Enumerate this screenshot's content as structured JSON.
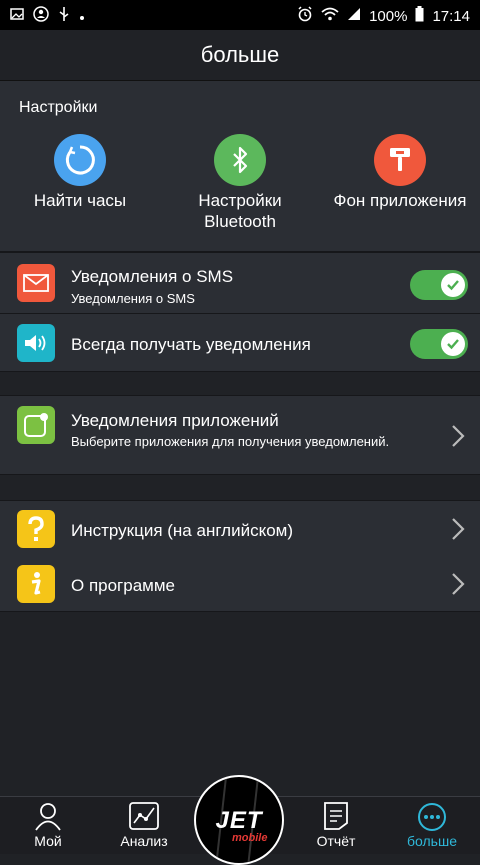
{
  "status_bar": {
    "battery": "100%",
    "time": "17:14"
  },
  "header": {
    "title": "больше"
  },
  "settings": {
    "label": "Настройки",
    "quick_actions": [
      {
        "label": "Найти часы",
        "icon": "find-watch-icon",
        "color": "#4aa3ef"
      },
      {
        "label_line1": "Настройки",
        "label_line2": "Bluetooth",
        "icon": "bluetooth-icon",
        "color": "#5cb85c"
      },
      {
        "label": "Фон приложения",
        "icon": "paint-roller-icon",
        "color": "#f0583c"
      }
    ]
  },
  "rows": {
    "sms": {
      "title": "Уведомления о SMS",
      "subtitle": "Уведомления о SMS",
      "enabled": true,
      "icon": "envelope-icon",
      "color": "#f0583c"
    },
    "always": {
      "title": "Всегда получать уведомления",
      "enabled": true,
      "icon": "speaker-icon",
      "color": "#1fb5c9"
    },
    "apps": {
      "title": "Уведомления приложений",
      "subtitle": "Выберите приложения для получения уведомлений.",
      "icon": "app-notification-icon",
      "color": "#7cc142"
    },
    "instructions": {
      "title": "Инструкция (на английском)",
      "icon": "question-icon",
      "color": "#f5c518"
    },
    "about": {
      "title": "О программе",
      "icon": "info-icon",
      "color": "#f5c518"
    }
  },
  "bottom_nav": {
    "tabs": [
      {
        "label": "Мой",
        "icon": "person-icon",
        "active": false
      },
      {
        "label": "Анализ",
        "icon": "chart-icon",
        "active": false
      },
      {
        "label": "Отчёт",
        "icon": "report-icon",
        "active": false
      },
      {
        "label": "больше",
        "icon": "more-icon",
        "active": true
      }
    ],
    "center_logo": "JET",
    "center_logo_sub": "mobile",
    "accent_color": "#2fb8d9"
  }
}
